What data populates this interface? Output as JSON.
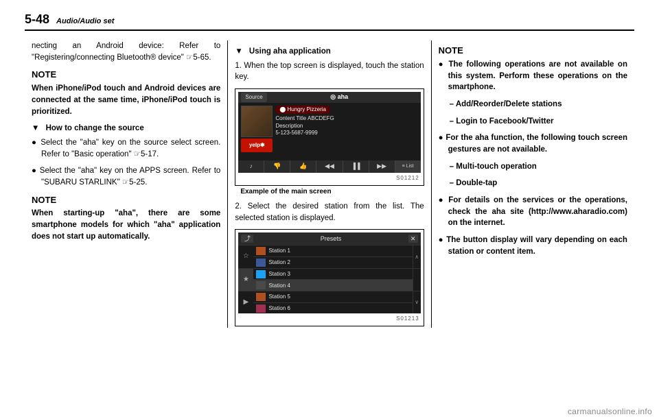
{
  "header": {
    "page_num": "5-48",
    "section": "Audio/Audio set"
  },
  "col1": {
    "p1": "necting an Android device: Refer to \"Registering/connecting Bluetooth® device\" ☞5-65.",
    "note1_title": "NOTE",
    "note1_body": "When iPhone/iPod touch and Android devices are connected at the same time, iPhone/iPod touch is prioritized.",
    "sub1": "How to change the source",
    "b1": "Select the \"aha\" key on the source select screen. Refer to \"Basic operation\" ☞5-17.",
    "b2": "Select the \"aha\" key on the APPS screen. Refer to \"SUBARU STARLINK\" ☞5-25.",
    "note2_title": "NOTE",
    "note2_body": "When starting-up \"aha\", there are some smartphone models for which \"aha\" application does not start up automatically."
  },
  "col2": {
    "sub1": "Using aha application",
    "p1": "1. When the top screen is displayed, touch the station key.",
    "screen1": {
      "source_btn": "Source",
      "brand": "◎ aha",
      "tag": "⬤ Hungry Pizzeria",
      "line1": "Content Title ABCDEFG",
      "line2": "Description",
      "line3": "5-123-5687-9999",
      "yelp": "yelp✱",
      "controls": [
        "♪",
        "👎",
        "👍",
        "◀◀",
        "▐▐",
        "▶▶",
        "≡ List"
      ],
      "code": "S01212"
    },
    "caption1": "Example of the main screen",
    "p2": "2. Select the desired station from the list. The selected station is displayed.",
    "screen2": {
      "title": "Presets",
      "back": "⤴",
      "close": "✕",
      "side": [
        "☆",
        "★",
        "▶"
      ],
      "rows": [
        "Station 1",
        "Station 2",
        "Station 3",
        "Station 4",
        "Station 5",
        "Station 6"
      ],
      "scroll": [
        "∧",
        "∨"
      ],
      "code": "S01213"
    }
  },
  "col3": {
    "note_title": "NOTE",
    "b1": "The following operations are not available on this system. Perform these operations on the smartphone.",
    "d1": "– Add/Reorder/Delete stations",
    "d2": "– Login to Facebook/Twitter",
    "b2": "For the aha function, the following touch screen gestures are not available.",
    "d3": "– Multi-touch operation",
    "d4": "– Double-tap",
    "b3": "For details on the services or the operations, check the aha site (http://www.aharadio.com) on the internet.",
    "b4": "The button display will vary depending on each station or content item."
  },
  "watermark": "carmanualsonline.info"
}
